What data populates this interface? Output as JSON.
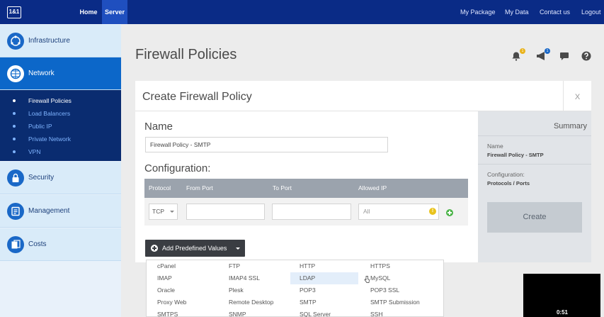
{
  "topbar": {
    "logo": "1&1",
    "nav_left": [
      "Home",
      "Server"
    ],
    "nav_right": [
      "My Package",
      "My Data",
      "Contact us",
      "Logout"
    ]
  },
  "sidebar": {
    "items": [
      {
        "label": "Infrastructure",
        "icon": "globe-icon"
      },
      {
        "label": "Network",
        "icon": "network-icon"
      },
      {
        "label": "Security",
        "icon": "lock-icon"
      },
      {
        "label": "Management",
        "icon": "management-icon"
      },
      {
        "label": "Costs",
        "icon": "costs-icon"
      }
    ],
    "submenu": [
      "Firewall Policies",
      "Load Balancers",
      "Public IP",
      "Private Network",
      "VPN"
    ]
  },
  "page": {
    "title": "Firewall Policies",
    "notification_badge": "1",
    "announcement_badge": "1"
  },
  "dialog": {
    "title": "Create Firewall Policy",
    "close": "X",
    "name_label": "Name",
    "name_value": "Firewall Policy - SMTP",
    "config_label": "Configuration:",
    "columns": [
      "Protocol",
      "From Port",
      "To Port",
      "Allowed IP"
    ],
    "row": {
      "protocol": "TCP",
      "from_port": "",
      "to_port": "",
      "allowed_ip_placeholder": "All"
    },
    "warn_glyph": "!",
    "predefined_button": "Add Predefined Values"
  },
  "summary": {
    "title": "Summary",
    "name_key": "Name",
    "name_value": "Firewall Policy - SMTP",
    "config_key": "Configuration:",
    "config_value": "Protocols / Ports",
    "create_button": "Create"
  },
  "dropdown": {
    "rows": [
      [
        "cPanel",
        "FTP",
        "HTTP",
        "HTTPS"
      ],
      [
        "IMAP",
        "IMAP4 SSL",
        "LDAP",
        "MySQL"
      ],
      [
        "Oracle",
        "Plesk",
        "POP3",
        "POP3 SSL"
      ],
      [
        "Proxy Web",
        "Remote Desktop",
        "SMTP",
        "SMTP Submission"
      ],
      [
        "SMTPS",
        "SNMP",
        "SQL Server",
        "SSH"
      ]
    ],
    "highlighted": "LDAP"
  },
  "video": {
    "time": "0:51"
  },
  "colors": {
    "topbar": "#0a2b86",
    "active_nav": "#0c67c9",
    "submenu_bg": "#0a2c70",
    "table_head": "#9ba3ad"
  }
}
